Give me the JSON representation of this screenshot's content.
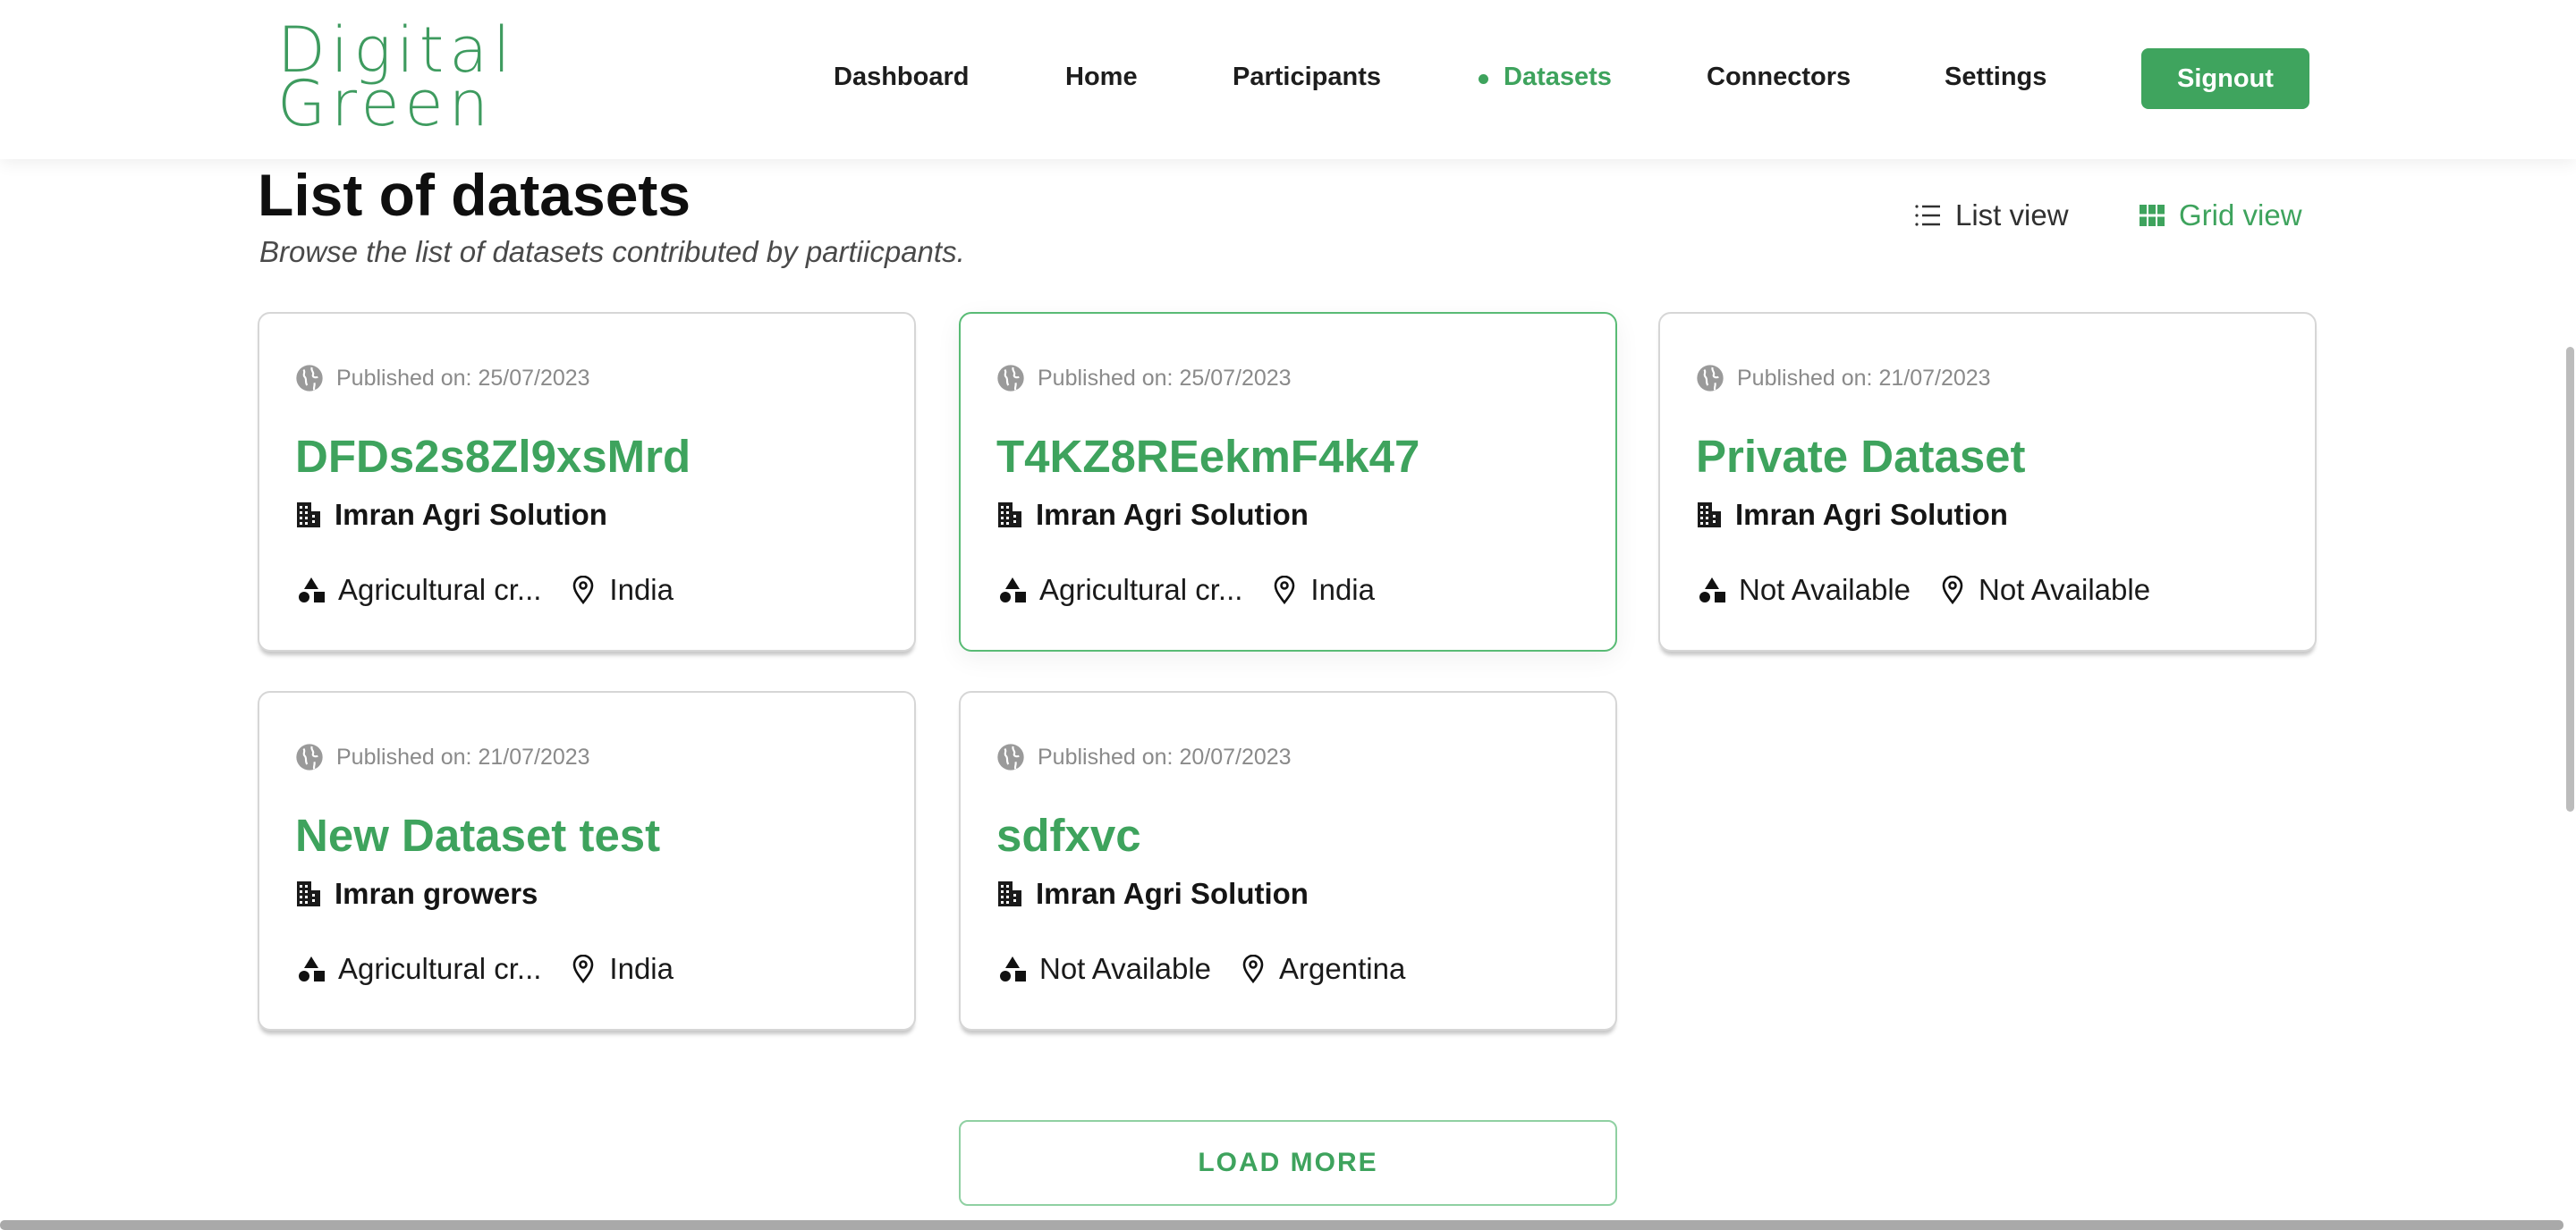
{
  "header": {
    "logo_line1": "Digital",
    "logo_line2": "Green",
    "nav": [
      {
        "label": "Dashboard"
      },
      {
        "label": "Home"
      },
      {
        "label": "Participants"
      },
      {
        "label": "Datasets",
        "active": true
      },
      {
        "label": "Connectors"
      },
      {
        "label": "Settings"
      }
    ],
    "signout_label": "Signout"
  },
  "main": {
    "title": "List of datasets",
    "subtitle": "Browse the list of datasets contributed by partiicpants.",
    "list_view_label": "List view",
    "grid_view_label": "Grid view",
    "active_view": "grid"
  },
  "datasets": [
    {
      "published": "Published on: 25/07/2023",
      "title": "DFDs2s8Zl9xsMrd",
      "org": "Imran Agri Solution",
      "category": "Agricultural cr...",
      "location": "India"
    },
    {
      "published": "Published on: 25/07/2023",
      "title": "T4KZ8REekmF4k47",
      "org": "Imran Agri Solution",
      "category": "Agricultural cr...",
      "location": "India"
    },
    {
      "published": "Published on: 21/07/2023",
      "title": "Private Dataset",
      "org": "Imran Agri Solution",
      "category": "Not Available",
      "location": "Not Available"
    },
    {
      "published": "Published on: 21/07/2023",
      "title": "New Dataset test",
      "org": "Imran growers",
      "category": "Agricultural cr...",
      "location": "India"
    },
    {
      "published": "Published on: 20/07/2023",
      "title": "sdfxvc",
      "org": "Imran Agri Solution",
      "category": "Not Available",
      "location": "Argentina"
    }
  ],
  "load_more_label": "LOAD MORE",
  "colors": {
    "brand_green": "#3ea35d",
    "signout_bg": "#3fa45e",
    "card_border": "#d6d6d6",
    "card_highlight_border": "#59bb75"
  },
  "icons": {
    "published": "globe-icon",
    "org": "building-icon",
    "category": "shapes-icon",
    "location": "map-pin-icon",
    "list_view": "list-icon",
    "grid_view": "grid-icon"
  }
}
